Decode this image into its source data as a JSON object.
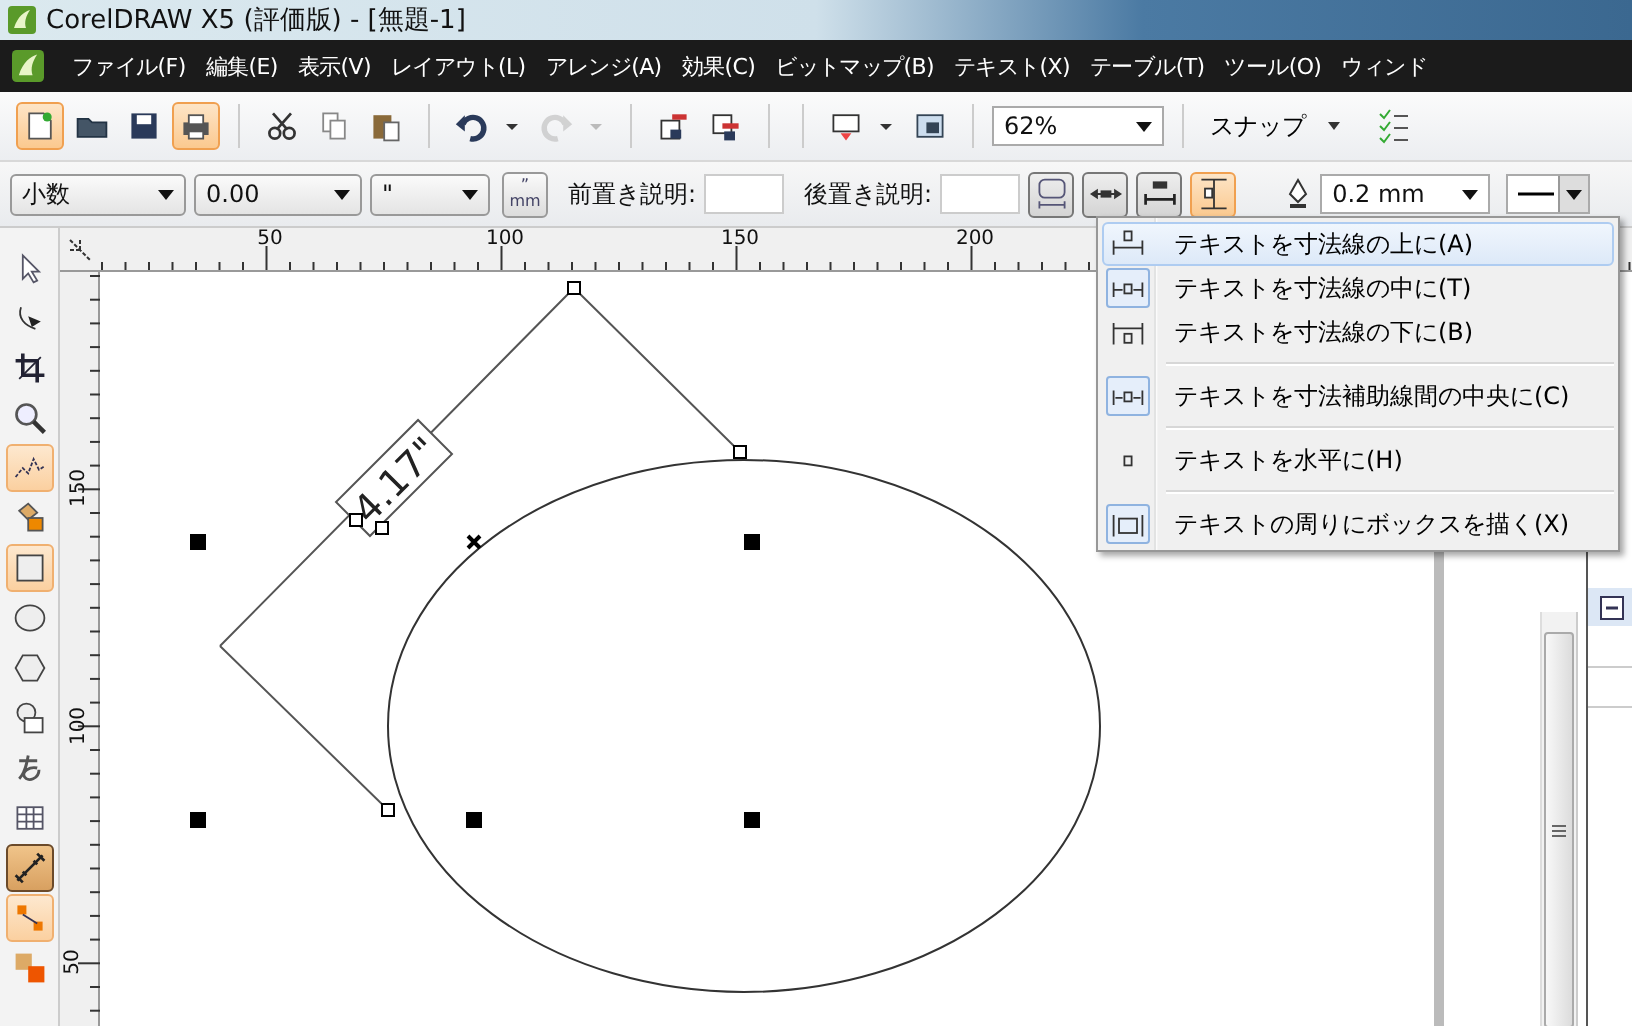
{
  "window": {
    "title": "CorelDRAW X5 (評価版) - [無題-1]"
  },
  "menu_bar": [
    "ファイル(F)",
    "編集(E)",
    "表示(V)",
    "レイアウト(L)",
    "アレンジ(A)",
    "効果(C)",
    "ビットマップ(B)",
    "テキスト(X)",
    "テーブル(T)",
    "ツール(O)",
    "ウィンド"
  ],
  "toolbar": {
    "buttons": [
      {
        "toggled": true,
        "disabled": false
      },
      {
        "toggled": false,
        "disabled": false
      },
      {
        "toggled": false,
        "disabled": false
      },
      {
        "toggled": true,
        "disabled": false
      },
      {
        "toggled": false,
        "disabled": false
      },
      {
        "toggled": false,
        "disabled": false
      },
      {
        "toggled": false,
        "disabled": false
      },
      {
        "toggled": false,
        "disabled": false
      },
      {
        "toggled": false,
        "disabled": true
      },
      {
        "toggled": false,
        "disabled": false
      },
      {
        "toggled": false,
        "disabled": false
      },
      {
        "toggled": false,
        "disabled": false
      },
      {
        "toggled": false,
        "disabled": false
      }
    ],
    "zoom": "62%",
    "snap": "スナップ"
  },
  "property_bar": {
    "style": "小数",
    "precision": "0.00",
    "units": "\"",
    "units_toggle": {
      "mark": "”",
      "unit": "mm"
    },
    "prefix_label": "前置き説明:",
    "suffix_label": "後置き説明:",
    "text_buttons": [
      {
        "pressed": true,
        "hot": false
      },
      {
        "pressed": true,
        "hot": false
      },
      {
        "pressed": true,
        "hot": false
      },
      {
        "pressed": false,
        "hot": true
      }
    ],
    "outline_width": "0.2 mm"
  },
  "tools": [
    {
      "selected": false,
      "hot": false
    },
    {
      "selected": false,
      "hot": false
    },
    {
      "selected": false,
      "hot": false
    },
    {
      "selected": false,
      "hot": false
    },
    {
      "selected": false,
      "hot": true
    },
    {
      "selected": false,
      "hot": false
    },
    {
      "selected": false,
      "hot": true
    },
    {
      "selected": false,
      "hot": false
    },
    {
      "selected": false,
      "hot": false
    },
    {
      "selected": false,
      "hot": false
    },
    {
      "selected": false,
      "hot": false
    },
    {
      "selected": false,
      "hot": false
    },
    {
      "selected": true,
      "hot": false
    },
    {
      "selected": false,
      "hot": true
    },
    {
      "selected": false,
      "hot": false
    }
  ],
  "horizontal_ruler": [
    "50",
    "100",
    "150",
    "200"
  ],
  "vertical_ruler": [
    "150",
    "100",
    "50"
  ],
  "canvas": {
    "dimension_text": "4.17\""
  },
  "text_position_menu": {
    "items": [
      {
        "label": "テキストを寸法線の上に(A)",
        "selected": true,
        "checked": false,
        "separator_before": false
      },
      {
        "label": "テキストを寸法線の中に(T)",
        "selected": false,
        "checked": true,
        "separator_before": false
      },
      {
        "label": "テキストを寸法線の下に(B)",
        "selected": false,
        "checked": false,
        "separator_before": false
      },
      {
        "label": "テキストを寸法補助線間の中央に(C)",
        "selected": false,
        "checked": true,
        "separator_before": true
      },
      {
        "label": "テキストを水平に(H)",
        "selected": false,
        "checked": false,
        "separator_before": true
      },
      {
        "label": "テキストの周りにボックスを描く(X)",
        "selected": false,
        "checked": true,
        "separator_before": true
      }
    ]
  }
}
